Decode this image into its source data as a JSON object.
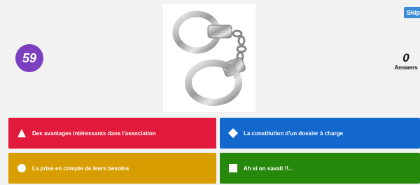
{
  "timer": {
    "value": "59"
  },
  "skip_button": {
    "label": "Skip"
  },
  "answers_counter": {
    "count": "0",
    "label": "Answers"
  },
  "question_image": {
    "depicts": "handcuffs"
  },
  "answer_options": [
    {
      "shape": "triangle",
      "color": "#e21b3c",
      "label": "Des avantages intéressants dans l'association"
    },
    {
      "shape": "diamond",
      "color": "#1368ce",
      "label": "La constitution d'un dossier à charge"
    },
    {
      "shape": "circle",
      "color": "#d89e00",
      "label": "La prise en compte de leurs besoins"
    },
    {
      "shape": "square",
      "color": "#26890c",
      "label": "Ah si on savait !!..."
    }
  ]
}
